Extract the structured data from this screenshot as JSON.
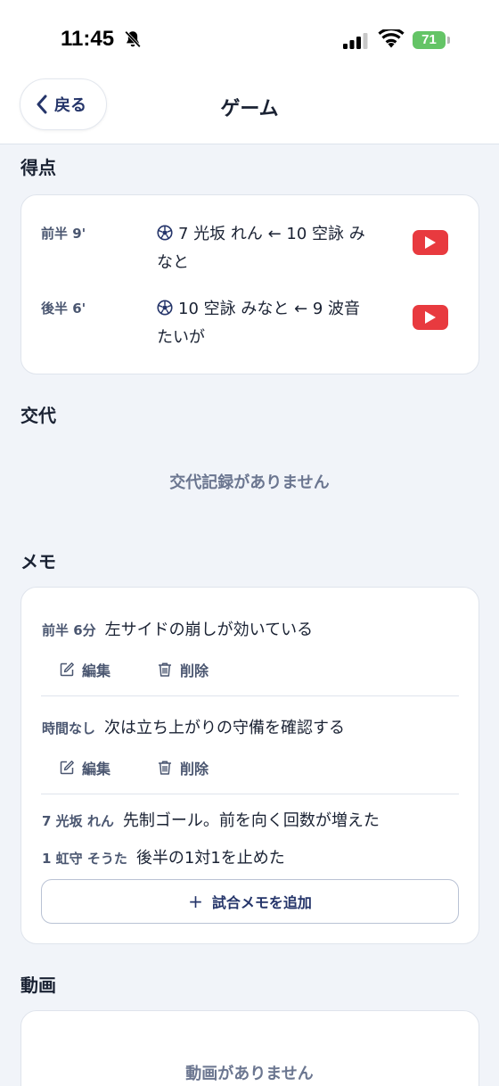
{
  "status_bar": {
    "time": "11:45",
    "battery": "71"
  },
  "nav": {
    "back_label": "戻る",
    "title": "ゲーム"
  },
  "goals_section": {
    "heading": "得点",
    "goals": [
      {
        "time": "前半 9'",
        "description": "7 光坂 れん ← 10 空詠 みなと",
        "line1": "7 光坂 れん ← 10 空詠 み",
        "line2": "なと"
      },
      {
        "time": "後半 6'",
        "description": "10 空詠 みなと ← 9 波音 たいが",
        "line1": "10 空詠 みなと ← 9 波音",
        "line2": "たいが"
      }
    ]
  },
  "substitutions_section": {
    "heading": "交代",
    "empty_text": "交代記録がありません"
  },
  "memo_section": {
    "heading": "メモ",
    "memos": [
      {
        "meta": "前半 6分",
        "text": "左サイドの崩しが効いている"
      },
      {
        "meta": "時間なし",
        "text": "次は立ち上がりの守備を確認する"
      }
    ],
    "player_memos": [
      {
        "meta": "7 光坂 れん",
        "text": "先制ゴール。前を向く回数が増えた"
      },
      {
        "meta": "1 虹守 そうた",
        "text": "後半の1対1を止めた"
      }
    ],
    "edit_label": "編集",
    "delete_label": "削除",
    "add_label": "試合メモを追加"
  },
  "video_section": {
    "heading": "動画",
    "empty_text": "動画がありません"
  },
  "colors": {
    "accent": "#25356a",
    "video_red": "#e83a3f",
    "battery_green": "#64c466"
  }
}
